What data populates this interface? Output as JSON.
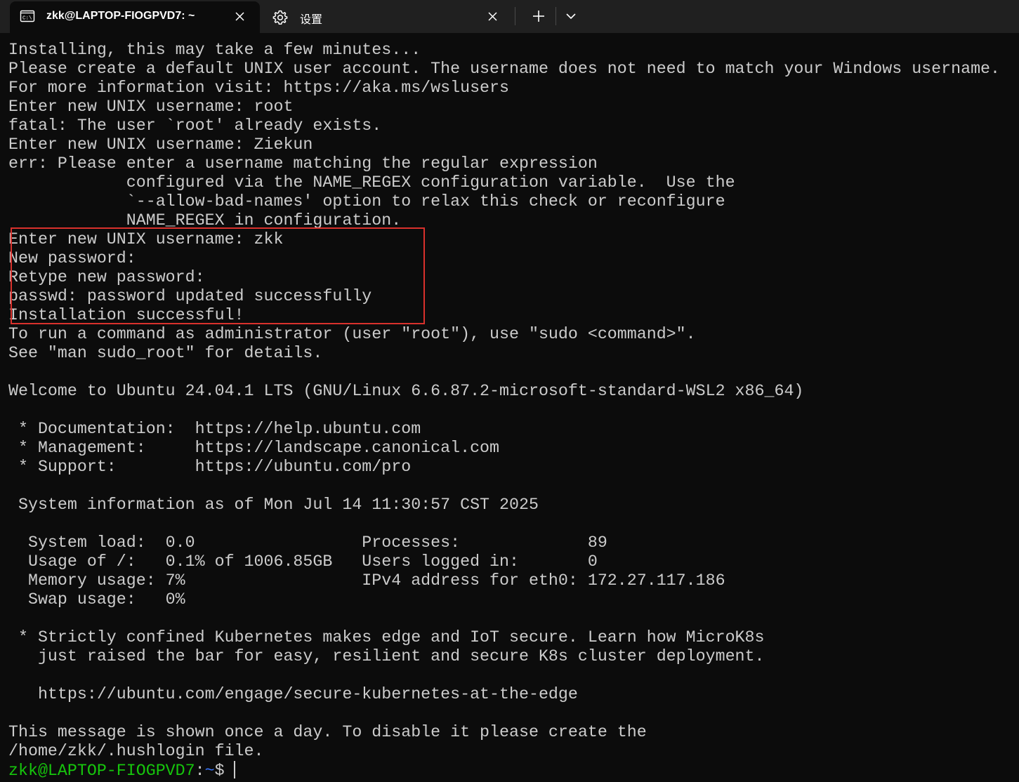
{
  "tabs": {
    "terminal": {
      "title": "zkk@LAPTOP-FIOGPVD7: ~",
      "icon": "terminal-icon"
    },
    "settings": {
      "title": "设置",
      "icon": "gear-icon"
    }
  },
  "terminal": {
    "lines": [
      "Installing, this may take a few minutes...",
      "Please create a default UNIX user account. The username does not need to match your Windows username.",
      "For more information visit: https://aka.ms/wslusers",
      "Enter new UNIX username: root",
      "fatal: The user `root' already exists.",
      "Enter new UNIX username: Ziekun",
      "err: Please enter a username matching the regular expression",
      "            configured via the NAME_REGEX configuration variable.  Use the",
      "            `--allow-bad-names' option to relax this check or reconfigure",
      "            NAME_REGEX in configuration.",
      "Enter new UNIX username: zkk",
      "New password:",
      "Retype new password:",
      "passwd: password updated successfully",
      "Installation successful!",
      "To run a command as administrator (user \"root\"), use \"sudo <command>\".",
      "See \"man sudo_root\" for details.",
      "",
      "Welcome to Ubuntu 24.04.1 LTS (GNU/Linux 6.6.87.2-microsoft-standard-WSL2 x86_64)",
      "",
      " * Documentation:  https://help.ubuntu.com",
      " * Management:     https://landscape.canonical.com",
      " * Support:        https://ubuntu.com/pro",
      "",
      " System information as of Mon Jul 14 11:30:57 CST 2025",
      "",
      "  System load:  0.0                 Processes:             89",
      "  Usage of /:   0.1% of 1006.85GB   Users logged in:       0",
      "  Memory usage: 7%                  IPv4 address for eth0: 172.27.117.186",
      "  Swap usage:   0%",
      "",
      " * Strictly confined Kubernetes makes edge and IoT secure. Learn how MicroK8s",
      "   just raised the bar for easy, resilient and secure K8s cluster deployment.",
      "",
      "   https://ubuntu.com/engage/secure-kubernetes-at-the-edge",
      "",
      "This message is shown once a day. To disable it please create the",
      "/home/zkk/.hushlogin file."
    ],
    "prompt": {
      "user_host": "zkk@LAPTOP-FIOGPVD7",
      "separator": ":",
      "path": "~",
      "symbol": "$"
    }
  },
  "colors": {
    "background": "#0c0c0c",
    "text": "#cccccc",
    "prompt_user": "#16c60c",
    "prompt_path": "#3b78ff",
    "highlight_box": "#d9312c"
  }
}
